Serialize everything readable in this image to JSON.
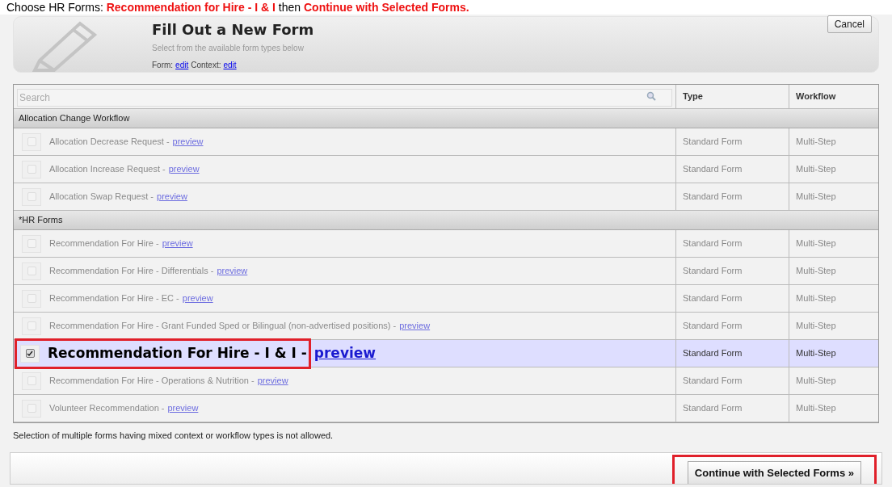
{
  "instruction": "Choose HR Forms: **Recommendation for Hire - I & I** then **Continue with Selected Forms.**",
  "header": {
    "title": "Fill Out a New Form",
    "subtitle": "Select from the available form types below",
    "form_label": "Form:",
    "form_link": "edit",
    "context_label": "Context:",
    "context_link": "edit",
    "cancel": "Cancel"
  },
  "table": {
    "search_placeholder": "Search",
    "columns": [
      "Type",
      "Workflow"
    ],
    "groups": [
      {
        "name": "Allocation Change Workflow",
        "items": [
          {
            "title": "Allocation Decrease Request -",
            "link": "preview",
            "type": "Standard Form",
            "workflow": "Multi-Step",
            "selected": false,
            "checked": false,
            "annotated": false
          },
          {
            "title": "Allocation Increase Request -",
            "link": "preview",
            "type": "Standard Form",
            "workflow": "Multi-Step",
            "selected": false,
            "checked": false,
            "annotated": false
          },
          {
            "title": "Allocation Swap Request -",
            "link": "preview",
            "type": "Standard Form",
            "workflow": "Multi-Step",
            "selected": false,
            "checked": false,
            "annotated": false
          }
        ]
      },
      {
        "name": "*HR Forms",
        "items": [
          {
            "title": "Recommendation For Hire -",
            "link": "preview",
            "type": "Standard Form",
            "workflow": "Multi-Step",
            "selected": false,
            "checked": false,
            "annotated": false
          },
          {
            "title": "Recommendation For Hire - Differentials -",
            "link": "preview",
            "type": "Standard Form",
            "workflow": "Multi-Step",
            "selected": false,
            "checked": false,
            "annotated": false
          },
          {
            "title": "Recommendation For Hire - EC -",
            "link": "preview",
            "type": "Standard Form",
            "workflow": "Multi-Step",
            "selected": false,
            "checked": false,
            "annotated": false
          },
          {
            "title": "Recommendation For Hire - Grant Funded Sped or Bilingual (non-advertised positions) -",
            "link": "preview",
            "type": "Standard Form",
            "workflow": "Multi-Step",
            "selected": false,
            "checked": false,
            "annotated": false
          },
          {
            "title": "Recommendation For Hire - I & I -",
            "link": "preview",
            "type": "Standard Form",
            "workflow": "Multi-Step",
            "selected": true,
            "checked": true,
            "annotated": true
          },
          {
            "title": "Recommendation For Hire - Operations & Nutrition -",
            "link": "preview",
            "type": "Standard Form",
            "workflow": "Multi-Step",
            "selected": false,
            "checked": false,
            "annotated": false
          },
          {
            "title": "Volunteer Recommendation -",
            "link": "preview",
            "type": "Standard Form",
            "workflow": "Multi-Step",
            "selected": false,
            "checked": false,
            "annotated": false
          }
        ]
      }
    ]
  },
  "note": "Selection of multiple forms having mixed context or workflow types is not allowed.",
  "footer": {
    "continue": "Continue with Selected Forms »",
    "annotated": true
  }
}
